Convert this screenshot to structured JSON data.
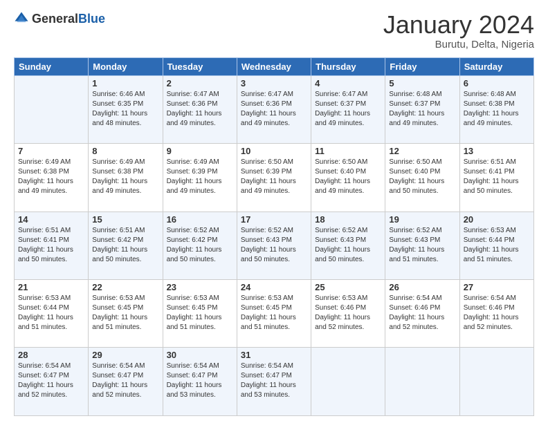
{
  "logo": {
    "general": "General",
    "blue": "Blue"
  },
  "title": "January 2024",
  "location": "Burutu, Delta, Nigeria",
  "weekdays": [
    "Sunday",
    "Monday",
    "Tuesday",
    "Wednesday",
    "Thursday",
    "Friday",
    "Saturday"
  ],
  "weeks": [
    [
      {
        "day": "",
        "info": ""
      },
      {
        "day": "1",
        "info": "Sunrise: 6:46 AM\nSunset: 6:35 PM\nDaylight: 11 hours\nand 48 minutes."
      },
      {
        "day": "2",
        "info": "Sunrise: 6:47 AM\nSunset: 6:36 PM\nDaylight: 11 hours\nand 49 minutes."
      },
      {
        "day": "3",
        "info": "Sunrise: 6:47 AM\nSunset: 6:36 PM\nDaylight: 11 hours\nand 49 minutes."
      },
      {
        "day": "4",
        "info": "Sunrise: 6:47 AM\nSunset: 6:37 PM\nDaylight: 11 hours\nand 49 minutes."
      },
      {
        "day": "5",
        "info": "Sunrise: 6:48 AM\nSunset: 6:37 PM\nDaylight: 11 hours\nand 49 minutes."
      },
      {
        "day": "6",
        "info": "Sunrise: 6:48 AM\nSunset: 6:38 PM\nDaylight: 11 hours\nand 49 minutes."
      }
    ],
    [
      {
        "day": "7",
        "info": "Sunrise: 6:49 AM\nSunset: 6:38 PM\nDaylight: 11 hours\nand 49 minutes."
      },
      {
        "day": "8",
        "info": "Sunrise: 6:49 AM\nSunset: 6:38 PM\nDaylight: 11 hours\nand 49 minutes."
      },
      {
        "day": "9",
        "info": "Sunrise: 6:49 AM\nSunset: 6:39 PM\nDaylight: 11 hours\nand 49 minutes."
      },
      {
        "day": "10",
        "info": "Sunrise: 6:50 AM\nSunset: 6:39 PM\nDaylight: 11 hours\nand 49 minutes."
      },
      {
        "day": "11",
        "info": "Sunrise: 6:50 AM\nSunset: 6:40 PM\nDaylight: 11 hours\nand 49 minutes."
      },
      {
        "day": "12",
        "info": "Sunrise: 6:50 AM\nSunset: 6:40 PM\nDaylight: 11 hours\nand 50 minutes."
      },
      {
        "day": "13",
        "info": "Sunrise: 6:51 AM\nSunset: 6:41 PM\nDaylight: 11 hours\nand 50 minutes."
      }
    ],
    [
      {
        "day": "14",
        "info": "Sunrise: 6:51 AM\nSunset: 6:41 PM\nDaylight: 11 hours\nand 50 minutes."
      },
      {
        "day": "15",
        "info": "Sunrise: 6:51 AM\nSunset: 6:42 PM\nDaylight: 11 hours\nand 50 minutes."
      },
      {
        "day": "16",
        "info": "Sunrise: 6:52 AM\nSunset: 6:42 PM\nDaylight: 11 hours\nand 50 minutes."
      },
      {
        "day": "17",
        "info": "Sunrise: 6:52 AM\nSunset: 6:43 PM\nDaylight: 11 hours\nand 50 minutes."
      },
      {
        "day": "18",
        "info": "Sunrise: 6:52 AM\nSunset: 6:43 PM\nDaylight: 11 hours\nand 50 minutes."
      },
      {
        "day": "19",
        "info": "Sunrise: 6:52 AM\nSunset: 6:43 PM\nDaylight: 11 hours\nand 51 minutes."
      },
      {
        "day": "20",
        "info": "Sunrise: 6:53 AM\nSunset: 6:44 PM\nDaylight: 11 hours\nand 51 minutes."
      }
    ],
    [
      {
        "day": "21",
        "info": "Sunrise: 6:53 AM\nSunset: 6:44 PM\nDaylight: 11 hours\nand 51 minutes."
      },
      {
        "day": "22",
        "info": "Sunrise: 6:53 AM\nSunset: 6:45 PM\nDaylight: 11 hours\nand 51 minutes."
      },
      {
        "day": "23",
        "info": "Sunrise: 6:53 AM\nSunset: 6:45 PM\nDaylight: 11 hours\nand 51 minutes."
      },
      {
        "day": "24",
        "info": "Sunrise: 6:53 AM\nSunset: 6:45 PM\nDaylight: 11 hours\nand 51 minutes."
      },
      {
        "day": "25",
        "info": "Sunrise: 6:53 AM\nSunset: 6:46 PM\nDaylight: 11 hours\nand 52 minutes."
      },
      {
        "day": "26",
        "info": "Sunrise: 6:54 AM\nSunset: 6:46 PM\nDaylight: 11 hours\nand 52 minutes."
      },
      {
        "day": "27",
        "info": "Sunrise: 6:54 AM\nSunset: 6:46 PM\nDaylight: 11 hours\nand 52 minutes."
      }
    ],
    [
      {
        "day": "28",
        "info": "Sunrise: 6:54 AM\nSunset: 6:47 PM\nDaylight: 11 hours\nand 52 minutes."
      },
      {
        "day": "29",
        "info": "Sunrise: 6:54 AM\nSunset: 6:47 PM\nDaylight: 11 hours\nand 52 minutes."
      },
      {
        "day": "30",
        "info": "Sunrise: 6:54 AM\nSunset: 6:47 PM\nDaylight: 11 hours\nand 53 minutes."
      },
      {
        "day": "31",
        "info": "Sunrise: 6:54 AM\nSunset: 6:47 PM\nDaylight: 11 hours\nand 53 minutes."
      },
      {
        "day": "",
        "info": ""
      },
      {
        "day": "",
        "info": ""
      },
      {
        "day": "",
        "info": ""
      }
    ]
  ]
}
